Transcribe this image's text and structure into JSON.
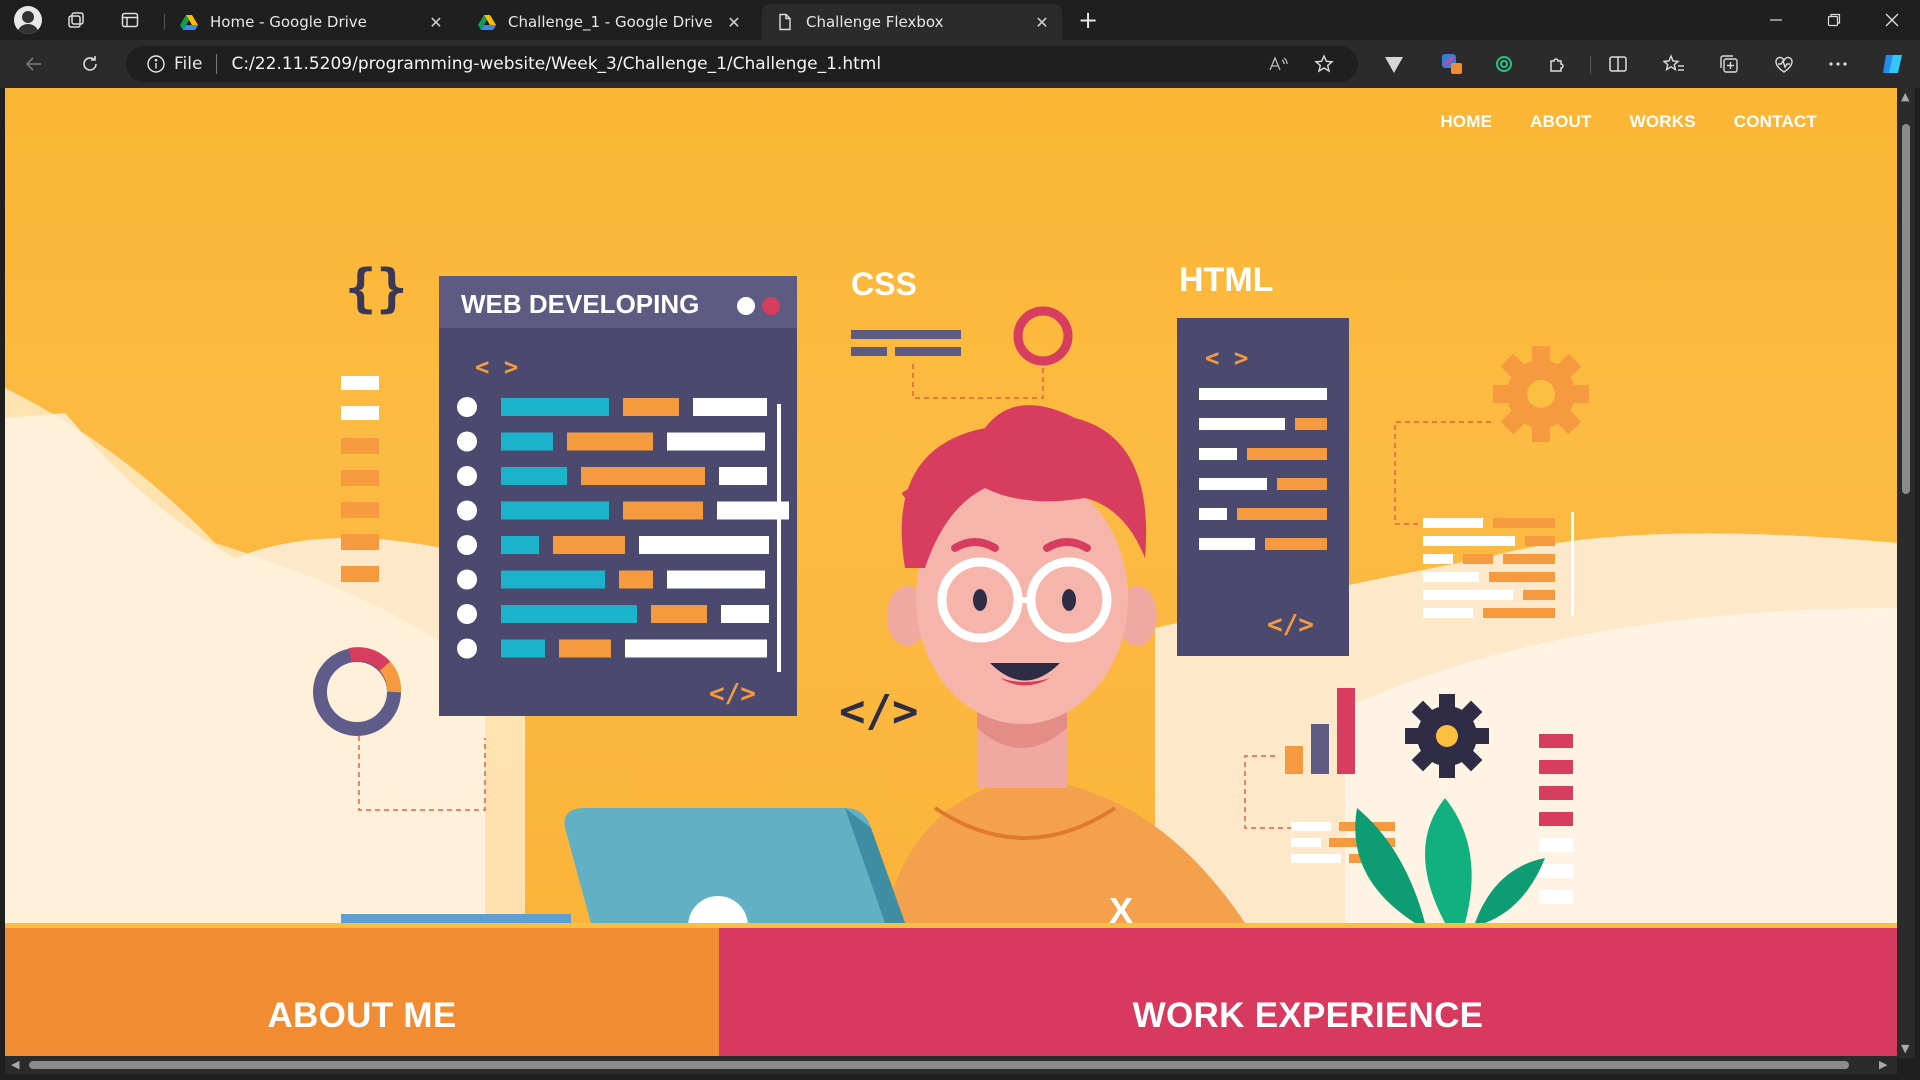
{
  "browser": {
    "tabs": [
      {
        "title": "Home - Google Drive",
        "favicon": "google-drive-icon",
        "active": false
      },
      {
        "title": "Challenge_1 - Google Drive",
        "favicon": "google-drive-icon",
        "active": false
      },
      {
        "title": "Challenge Flexbox",
        "favicon": "document-icon",
        "active": true
      }
    ],
    "address": {
      "scheme": "File",
      "url": "C:/22.11.5209/programming-website/Week_3/Challenge_1/Challenge_1.html"
    },
    "accent": "#1f1f1f"
  },
  "page": {
    "nav": [
      "HOME",
      "ABOUT",
      "WORKS",
      "CONTACT"
    ],
    "illustration": {
      "panel_title": "WEB DEVELOPING",
      "css_label": "CSS",
      "html_label": "HTML",
      "tag_open": "< >",
      "tag_close": "</>"
    },
    "sections": {
      "about_title": "ABOUT ME",
      "work_title": "WORK EXPERIENCE"
    },
    "colors": {
      "hero": "#fbb634",
      "about": "#f28c32",
      "work": "#d73a5e",
      "panel": "#4b4a6e",
      "teal": "#1ab3c9",
      "pink": "#d63d5f"
    }
  }
}
